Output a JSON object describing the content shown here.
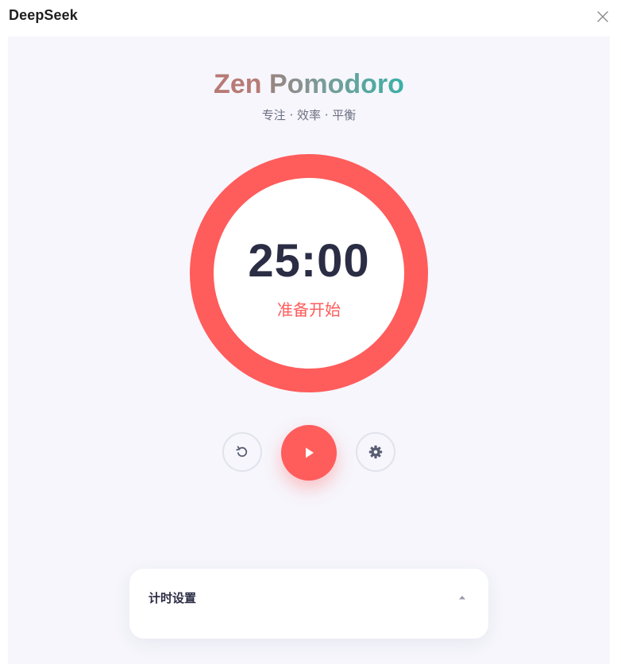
{
  "window": {
    "app_title": "DeepSeek",
    "close_icon": "close-icon"
  },
  "app": {
    "title_words": [
      "Zen",
      "Pomodoro"
    ],
    "title_gradient": [
      "#c97a72",
      "#3ab0a6"
    ],
    "subtitle": "专注 · 效率 · 平衡"
  },
  "timer": {
    "time": "25:00",
    "status": "准备开始",
    "ring_color": "#ff5c5c",
    "progress": 0
  },
  "controls": {
    "reset_icon": "reset-icon",
    "play_icon": "play-icon",
    "settings_icon": "gear-icon",
    "accent": "#ff5c5c"
  },
  "settings_panel": {
    "title": "计时设置",
    "toggle_icon": "caret-up-icon",
    "expanded": false
  }
}
